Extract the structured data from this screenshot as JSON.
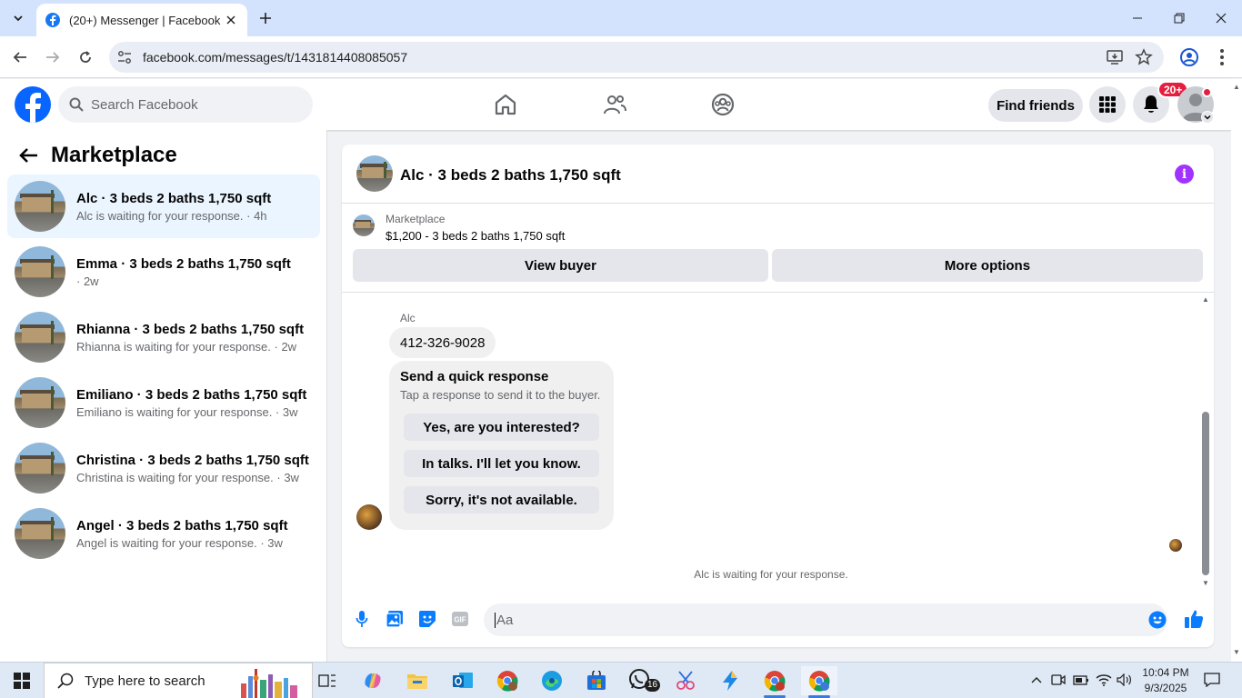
{
  "browser": {
    "tab_title": "(20+) Messenger | Facebook",
    "url": "facebook.com/messages/t/1431814408085057"
  },
  "header": {
    "search_placeholder": "Search Facebook",
    "find_friends": "Find friends",
    "notif_badge": "20+"
  },
  "sidebar": {
    "title": "Marketplace",
    "conversations": [
      {
        "name": "Alc · 3 beds 2 baths 1,750 sqft",
        "sub": "Alc is waiting for your response. · 4h"
      },
      {
        "name": "Emma · 3 beds 2 baths 1,750 sqft",
        "sub": "· 2w"
      },
      {
        "name": "Rhianna · 3 beds 2 baths 1,750 sqft",
        "sub": "Rhianna is waiting for your response. · 2w"
      },
      {
        "name": "Emiliano · 3 beds 2 baths 1,750 sqft",
        "sub": "Emiliano is waiting for your response. · 3w"
      },
      {
        "name": "Christina · 3 beds 2 baths 1,750 sqft",
        "sub": "Christina is waiting for your response. · 3w"
      },
      {
        "name": "Angel · 3 beds 2 baths 1,750 sqft",
        "sub": "Angel is waiting for your response. · 3w"
      }
    ]
  },
  "chat": {
    "title": "Alc · 3 beds 2 baths 1,750 sqft",
    "marketplace_label": "Marketplace",
    "listing": "$1,200 - 3 beds 2 baths 1,750 sqft",
    "view_buyer": "View buyer",
    "more_options": "More options",
    "sender": "Alc",
    "message": "412-326-9028",
    "quick_title": "Send a quick response",
    "quick_sub": "Tap a response to send it to the buyer.",
    "quick_options": [
      "Yes, are you interested?",
      "In talks. I'll let you know.",
      "Sorry, it's not available."
    ],
    "waiting": "Alc is waiting for your response.",
    "composer_placeholder": "Aa"
  },
  "taskbar": {
    "search_placeholder": "Type here to search",
    "whatsapp_badge": "16",
    "time": "10:04 PM",
    "date": "9/3/2025"
  },
  "colors": {
    "facebook_blue": "#0866ff",
    "messenger_blue": "#0a7cff",
    "active_conversation": "#ebf5ff",
    "info_purple": "#a033ff",
    "notification_red": "#e41e3f"
  }
}
